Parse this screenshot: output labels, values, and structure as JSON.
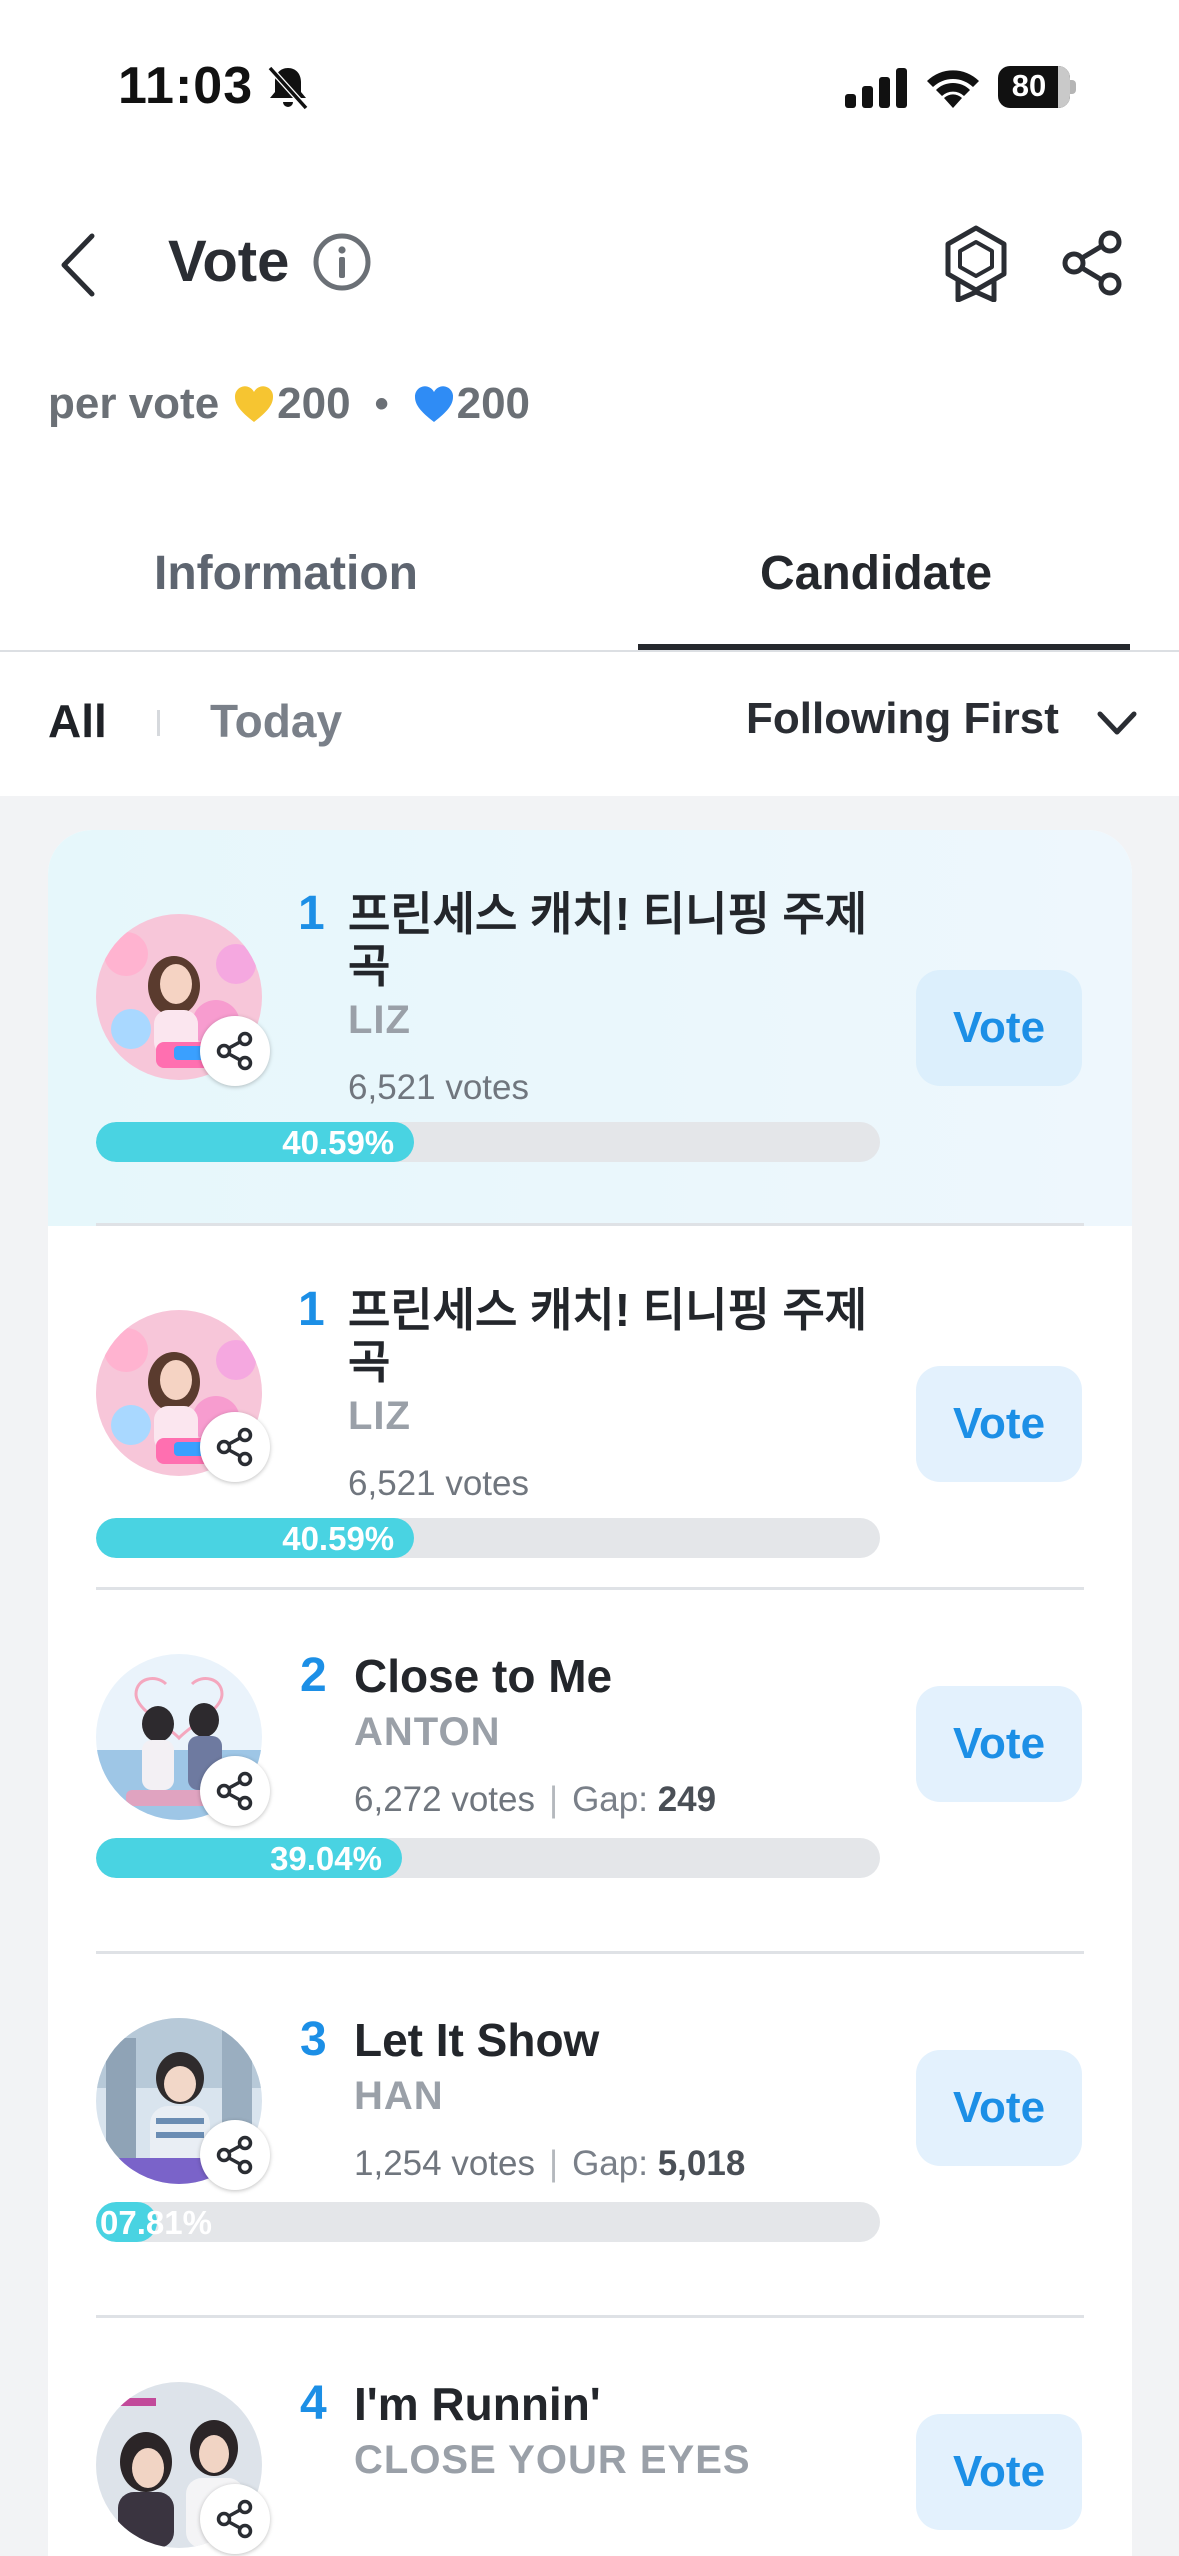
{
  "status_bar": {
    "time": "11:03",
    "battery": "80"
  },
  "header": {
    "title": "Vote"
  },
  "per_vote": {
    "label": "per vote",
    "gold_amount": "200",
    "separator": "•",
    "blue_amount": "200"
  },
  "tabs": [
    {
      "label": "Information",
      "active": false
    },
    {
      "label": "Candidate",
      "active": true
    }
  ],
  "filter": {
    "all": "All",
    "today": "Today",
    "sort": "Following First"
  },
  "vote_button_label": "Vote",
  "candidates": [
    {
      "rank": "1",
      "title": "프린세스 캐치! 티니핑 주제곡",
      "artist": "LIZ",
      "votes_num": "6,521",
      "votes_unit": "votes",
      "gap_label": "",
      "gap": "",
      "percent": "40.59%",
      "fill": 0.4059,
      "highlighted": true
    },
    {
      "rank": "1",
      "title": "프린세스 캐치! 티니핑 주제곡",
      "artist": "LIZ",
      "votes_num": "6,521",
      "votes_unit": "votes",
      "gap_label": "",
      "gap": "",
      "percent": "40.59%",
      "fill": 0.4059,
      "highlighted": false
    },
    {
      "rank": "2",
      "title": "Close to Me",
      "artist": "ANTON",
      "votes_num": "6,272",
      "votes_unit": "votes",
      "gap_label": "Gap:",
      "gap": "249",
      "percent": "39.04%",
      "fill": 0.3904,
      "highlighted": false
    },
    {
      "rank": "3",
      "title": "Let It Show",
      "artist": "HAN",
      "votes_num": "1,254",
      "votes_unit": "votes",
      "gap_label": "Gap:",
      "gap": "5,018",
      "percent": "07.81%",
      "fill": 0.0781,
      "highlighted": false
    },
    {
      "rank": "4",
      "title": "I'm Runnin'",
      "artist": "CLOSE YOUR EYES",
      "votes_num": "",
      "votes_unit": "",
      "gap_label": "",
      "gap": "",
      "percent": "",
      "fill": 0,
      "highlighted": false
    }
  ],
  "colors": {
    "accent": "#1c8fe6",
    "bar_fill": "#49d3e2",
    "heart_gold": "#f6c531",
    "heart_blue": "#2f8cf5"
  }
}
